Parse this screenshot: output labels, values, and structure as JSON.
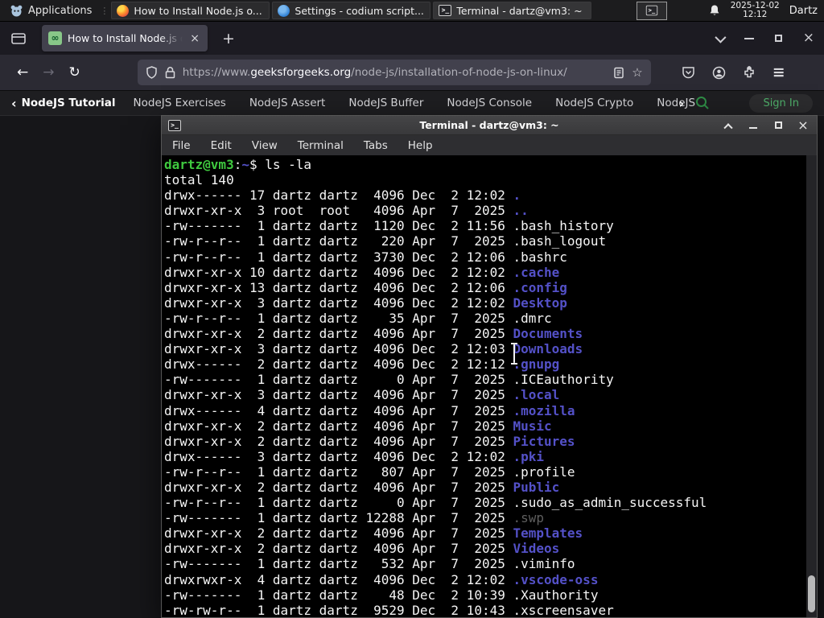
{
  "colors": {
    "gfg_green": "#2f8d46",
    "dir_blue": "#5451c8",
    "prompt_green": "#3fc93f",
    "dim_file": "#5f5f5f",
    "terminal_bg": "#000000",
    "panel_bg": "#1c1c1e",
    "firefox_tab_active": "#42414d"
  },
  "glyphs": {
    "plus": "+",
    "back_arrow": "←",
    "forward_arrow": "→",
    "reload": "↻",
    "star": "☆",
    "hamburger": "≡",
    "nav_back_chevron": "‹",
    "nav_more_chevron": "›",
    "tab_close": "×",
    "window_close": "×",
    "terminal_glyph": ">_"
  },
  "panel": {
    "applications_label": "Applications",
    "tasks": [
      {
        "title": "How to Install Node.js o...",
        "icon": "firefox",
        "active": false
      },
      {
        "title": "Settings - codium script...",
        "icon": "codium",
        "active": false
      },
      {
        "title": "Terminal - dartz@vm3: ~",
        "icon": "terminal",
        "active": true
      }
    ],
    "clock_date": "2025-12-02",
    "clock_time": "12:12",
    "user_label": "Dartz"
  },
  "browser": {
    "tab_title": "How to Install Node.js on",
    "favicon_text": "∞",
    "url": {
      "scheme": "https://www.",
      "domain": "geeksforgeeks.org",
      "path": "/node-js/installation-of-node-js-on-linux/"
    }
  },
  "site_nav": {
    "back_label": "NodeJS Tutorial",
    "items": [
      "NodeJS Exercises",
      "NodeJS Assert",
      "NodeJS Buffer",
      "NodeJS Console",
      "NodeJS Crypto",
      "NodeJS DNS",
      "Node"
    ],
    "sign_in_label": "Sign In"
  },
  "terminal": {
    "window_title": "Terminal - dartz@vm3: ~",
    "menus": [
      "File",
      "Edit",
      "View",
      "Terminal",
      "Tabs",
      "Help"
    ],
    "prompt": {
      "user": "dartz@vm3",
      "colon": ":",
      "path": "~",
      "dollar": "$ ",
      "command": "ls -la"
    },
    "total_line": "total 140",
    "listing": [
      {
        "pre": "drwx------ 17 dartz dartz  4096 Dec  2 12:02 ",
        "name": ".",
        "type": "dir"
      },
      {
        "pre": "drwxr-xr-x  3 root  root   4096 Apr  7  2025 ",
        "name": "..",
        "type": "dir"
      },
      {
        "pre": "-rw-------  1 dartz dartz  1120 Dec  2 11:56 ",
        "name": ".bash_history",
        "type": "file"
      },
      {
        "pre": "-rw-r--r--  1 dartz dartz   220 Apr  7  2025 ",
        "name": ".bash_logout",
        "type": "file"
      },
      {
        "pre": "-rw-r--r--  1 dartz dartz  3730 Dec  2 12:06 ",
        "name": ".bashrc",
        "type": "file"
      },
      {
        "pre": "drwxr-xr-x 10 dartz dartz  4096 Dec  2 12:02 ",
        "name": ".cache",
        "type": "dir"
      },
      {
        "pre": "drwxr-xr-x 13 dartz dartz  4096 Dec  2 12:06 ",
        "name": ".config",
        "type": "dir"
      },
      {
        "pre": "drwxr-xr-x  3 dartz dartz  4096 Dec  2 12:02 ",
        "name": "Desktop",
        "type": "dir"
      },
      {
        "pre": "-rw-r--r--  1 dartz dartz    35 Apr  7  2025 ",
        "name": ".dmrc",
        "type": "file"
      },
      {
        "pre": "drwxr-xr-x  2 dartz dartz  4096 Apr  7  2025 ",
        "name": "Documents",
        "type": "dir"
      },
      {
        "pre": "drwxr-xr-x  3 dartz dartz  4096 Dec  2 12:03 ",
        "name": "Downloads",
        "type": "dir"
      },
      {
        "pre": "drwx------  2 dartz dartz  4096 Dec  2 12:12 ",
        "name": ".gnupg",
        "type": "dir"
      },
      {
        "pre": "-rw-------  1 dartz dartz     0 Apr  7  2025 ",
        "name": ".ICEauthority",
        "type": "file"
      },
      {
        "pre": "drwxr-xr-x  3 dartz dartz  4096 Apr  7  2025 ",
        "name": ".local",
        "type": "dir"
      },
      {
        "pre": "drwx------  4 dartz dartz  4096 Apr  7  2025 ",
        "name": ".mozilla",
        "type": "dir"
      },
      {
        "pre": "drwxr-xr-x  2 dartz dartz  4096 Apr  7  2025 ",
        "name": "Music",
        "type": "dir"
      },
      {
        "pre": "drwxr-xr-x  2 dartz dartz  4096 Apr  7  2025 ",
        "name": "Pictures",
        "type": "dir"
      },
      {
        "pre": "drwx------  3 dartz dartz  4096 Dec  2 12:02 ",
        "name": ".pki",
        "type": "dir"
      },
      {
        "pre": "-rw-r--r--  1 dartz dartz   807 Apr  7  2025 ",
        "name": ".profile",
        "type": "file"
      },
      {
        "pre": "drwxr-xr-x  2 dartz dartz  4096 Apr  7  2025 ",
        "name": "Public",
        "type": "dir"
      },
      {
        "pre": "-rw-r--r--  1 dartz dartz     0 Apr  7  2025 ",
        "name": ".sudo_as_admin_successful",
        "type": "file"
      },
      {
        "pre": "-rw-------  1 dartz dartz 12288 Apr  7  2025 ",
        "name": ".swp",
        "type": "dim"
      },
      {
        "pre": "drwxr-xr-x  2 dartz dartz  4096 Apr  7  2025 ",
        "name": "Templates",
        "type": "dir"
      },
      {
        "pre": "drwxr-xr-x  2 dartz dartz  4096 Apr  7  2025 ",
        "name": "Videos",
        "type": "dir"
      },
      {
        "pre": "-rw-------  1 dartz dartz   532 Apr  7  2025 ",
        "name": ".viminfo",
        "type": "file"
      },
      {
        "pre": "drwxrwxr-x  4 dartz dartz  4096 Dec  2 12:02 ",
        "name": ".vscode-oss",
        "type": "dir"
      },
      {
        "pre": "-rw-------  1 dartz dartz    48 Dec  2 10:39 ",
        "name": ".Xauthority",
        "type": "file"
      },
      {
        "pre": "-rw-rw-r--  1 dartz dartz  9529 Dec  2 10:43 ",
        "name": ".xscreensaver",
        "type": "file"
      }
    ]
  }
}
